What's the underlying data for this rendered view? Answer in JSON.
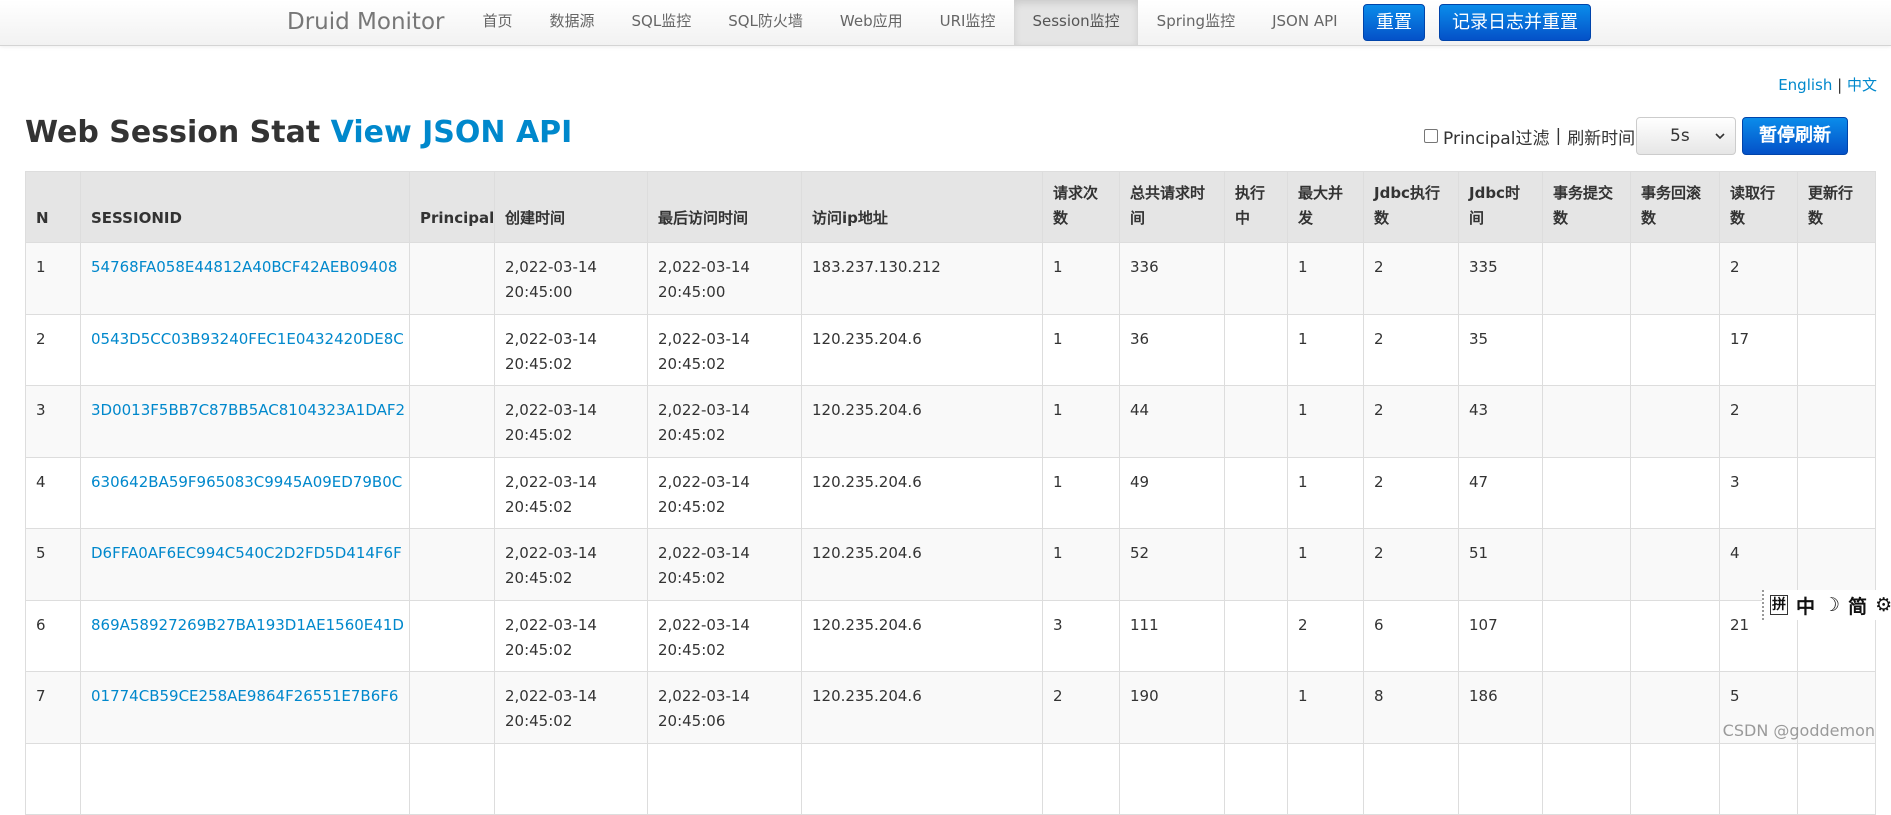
{
  "nav": {
    "brand": "Druid Monitor",
    "items": [
      {
        "label": "首页",
        "active": false
      },
      {
        "label": "数据源",
        "active": false
      },
      {
        "label": "SQL监控",
        "active": false
      },
      {
        "label": "SQL防火墙",
        "active": false
      },
      {
        "label": "Web应用",
        "active": false
      },
      {
        "label": "URI监控",
        "active": false
      },
      {
        "label": "Session监控",
        "active": true
      },
      {
        "label": "Spring监控",
        "active": false
      },
      {
        "label": "JSON API",
        "active": false
      }
    ],
    "reset_label": "重置",
    "log_reset_label": "记录日志并重置"
  },
  "lang": {
    "english": "English",
    "separator": "|",
    "chinese": "中文"
  },
  "header": {
    "title": "Web Session Stat",
    "json_link": "View JSON API",
    "principal_filter_label": "Principal过滤",
    "separator": "|",
    "refresh_label": "刷新时间",
    "refresh_value": "5s",
    "pause_label": "暂停刷新"
  },
  "table": {
    "columns": [
      [
        "N"
      ],
      [
        "SESSIONID"
      ],
      [
        "Principal"
      ],
      [
        "创建时间"
      ],
      [
        "最后访问时间"
      ],
      [
        "访问ip地址"
      ],
      [
        "请求次",
        "数"
      ],
      [
        "总共请求时",
        "间"
      ],
      [
        "执行",
        "中"
      ],
      [
        "最大并",
        "发"
      ],
      [
        "Jdbc执行",
        "数"
      ],
      [
        "Jdbc时",
        "间"
      ],
      [
        "事务提交",
        "数"
      ],
      [
        "事务回滚",
        "数"
      ],
      [
        "读取行",
        "数"
      ],
      [
        "更新行",
        "数"
      ]
    ],
    "rows": [
      {
        "n": "1",
        "sessionid": "54768FA058E44812A40BCF42AEB09408",
        "principal": "",
        "created_date": "2,022-03-14",
        "created_time": "20:45:00",
        "last_date": "2,022-03-14",
        "last_time": "20:45:00",
        "ip": "183.237.130.212",
        "requests": "1",
        "total_time": "336",
        "running": "",
        "max_concurrent": "1",
        "jdbc_exec": "2",
        "jdbc_time": "335",
        "tx_commit": "",
        "tx_rollback": "",
        "rows_read": "2",
        "rows_updated": ""
      },
      {
        "n": "2",
        "sessionid": "0543D5CC03B93240FEC1E0432420DE8C",
        "principal": "",
        "created_date": "2,022-03-14",
        "created_time": "20:45:02",
        "last_date": "2,022-03-14",
        "last_time": "20:45:02",
        "ip": "120.235.204.6",
        "requests": "1",
        "total_time": "36",
        "running": "",
        "max_concurrent": "1",
        "jdbc_exec": "2",
        "jdbc_time": "35",
        "tx_commit": "",
        "tx_rollback": "",
        "rows_read": "17",
        "rows_updated": ""
      },
      {
        "n": "3",
        "sessionid": "3D0013F5BB7C87BB5AC8104323A1DAF2",
        "principal": "",
        "created_date": "2,022-03-14",
        "created_time": "20:45:02",
        "last_date": "2,022-03-14",
        "last_time": "20:45:02",
        "ip": "120.235.204.6",
        "requests": "1",
        "total_time": "44",
        "running": "",
        "max_concurrent": "1",
        "jdbc_exec": "2",
        "jdbc_time": "43",
        "tx_commit": "",
        "tx_rollback": "",
        "rows_read": "2",
        "rows_updated": ""
      },
      {
        "n": "4",
        "sessionid": "630642BA59F965083C9945A09ED79B0C",
        "principal": "",
        "created_date": "2,022-03-14",
        "created_time": "20:45:02",
        "last_date": "2,022-03-14",
        "last_time": "20:45:02",
        "ip": "120.235.204.6",
        "requests": "1",
        "total_time": "49",
        "running": "",
        "max_concurrent": "1",
        "jdbc_exec": "2",
        "jdbc_time": "47",
        "tx_commit": "",
        "tx_rollback": "",
        "rows_read": "3",
        "rows_updated": ""
      },
      {
        "n": "5",
        "sessionid": "D6FFA0AF6EC994C540C2D2FD5D414F6F",
        "principal": "",
        "created_date": "2,022-03-14",
        "created_time": "20:45:02",
        "last_date": "2,022-03-14",
        "last_time": "20:45:02",
        "ip": "120.235.204.6",
        "requests": "1",
        "total_time": "52",
        "running": "",
        "max_concurrent": "1",
        "jdbc_exec": "2",
        "jdbc_time": "51",
        "tx_commit": "",
        "tx_rollback": "",
        "rows_read": "4",
        "rows_updated": ""
      },
      {
        "n": "6",
        "sessionid": "869A58927269B27BA193D1AE1560E41D",
        "principal": "",
        "created_date": "2,022-03-14",
        "created_time": "20:45:02",
        "last_date": "2,022-03-14",
        "last_time": "20:45:02",
        "ip": "120.235.204.6",
        "requests": "3",
        "total_time": "111",
        "running": "",
        "max_concurrent": "2",
        "jdbc_exec": "6",
        "jdbc_time": "107",
        "tx_commit": "",
        "tx_rollback": "",
        "rows_read": "21",
        "rows_updated": ""
      },
      {
        "n": "7",
        "sessionid": "01774CB59CE258AE9864F26551E7B6F6",
        "principal": "",
        "created_date": "2,022-03-14",
        "created_time": "20:45:02",
        "last_date": "2,022-03-14",
        "last_time": "20:45:06",
        "ip": "120.235.204.6",
        "requests": "2",
        "total_time": "190",
        "running": "",
        "max_concurrent": "1",
        "jdbc_exec": "8",
        "jdbc_time": "186",
        "tx_commit": "",
        "tx_rollback": "",
        "rows_read": "5",
        "rows_updated": ""
      },
      {
        "n": "",
        "sessionid": "",
        "principal": "",
        "created_date": "",
        "created_time": "",
        "last_date": "",
        "last_time": "",
        "ip": "",
        "requests": "",
        "total_time": "",
        "running": "",
        "max_concurrent": "",
        "jdbc_exec": "",
        "jdbc_time": "",
        "tx_commit": "",
        "tx_rollback": "",
        "rows_read": "",
        "rows_updated": ""
      }
    ]
  },
  "ime": {
    "items": [
      {
        "name": "grid-icon",
        "glyph": "拼"
      },
      {
        "name": "chinese-mode-icon",
        "glyph": "中"
      },
      {
        "name": "moon-icon",
        "glyph": "☽"
      },
      {
        "name": "simplified-icon",
        "glyph": "简"
      },
      {
        "name": "gear-icon",
        "glyph": "⚙"
      }
    ]
  },
  "watermark": "CSDN @goddemon",
  "colors": {
    "link": "#0088cc",
    "primary_button": "#0451c8",
    "header_bg": "#e5e5e5"
  }
}
